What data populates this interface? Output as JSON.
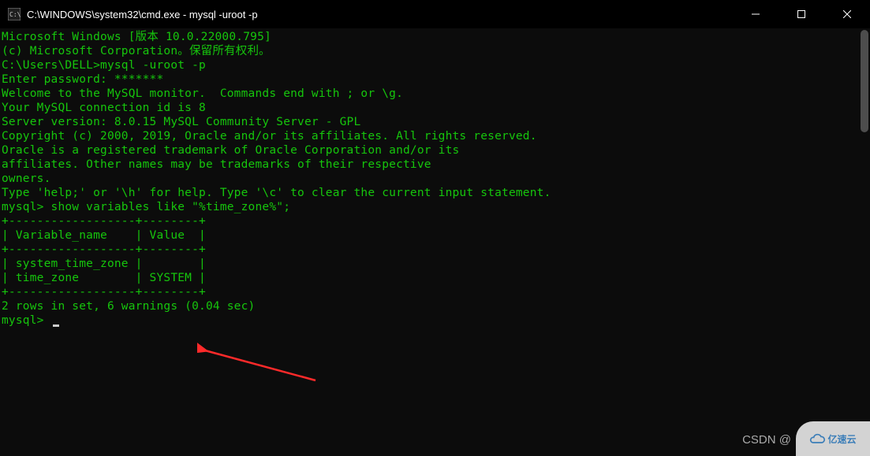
{
  "window": {
    "title": "C:\\WINDOWS\\system32\\cmd.exe - mysql  -uroot -p"
  },
  "terminal": {
    "lines": [
      "Microsoft Windows [版本 10.0.22000.795]",
      "(c) Microsoft Corporation。保留所有权利。",
      "",
      "C:\\Users\\DELL>mysql -uroot -p",
      "Enter password: *******",
      "Welcome to the MySQL monitor.  Commands end with ; or \\g.",
      "Your MySQL connection id is 8",
      "Server version: 8.0.15 MySQL Community Server - GPL",
      "",
      "Copyright (c) 2000, 2019, Oracle and/or its affiliates. All rights reserved.",
      "",
      "Oracle is a registered trademark of Oracle Corporation and/or its",
      "affiliates. Other names may be trademarks of their respective",
      "owners.",
      "",
      "Type 'help;' or '\\h' for help. Type '\\c' to clear the current input statement.",
      "",
      "mysql> show variables like \"%time_zone%\";",
      "+------------------+--------+",
      "| Variable_name    | Value  |",
      "+------------------+--------+",
      "| system_time_zone |        |",
      "| time_zone        | SYSTEM |",
      "+------------------+--------+",
      "2 rows in set, 6 warnings (0.04 sec)",
      "",
      "mysql> "
    ],
    "query_result": {
      "columns": [
        "Variable_name",
        "Value"
      ],
      "rows": [
        [
          "system_time_zone",
          ""
        ],
        [
          "time_zone",
          "SYSTEM"
        ]
      ],
      "summary": "2 rows in set, 6 warnings (0.04 sec)"
    }
  },
  "watermark": {
    "csdn": "CSDN @",
    "logo_text": "亿速云"
  }
}
